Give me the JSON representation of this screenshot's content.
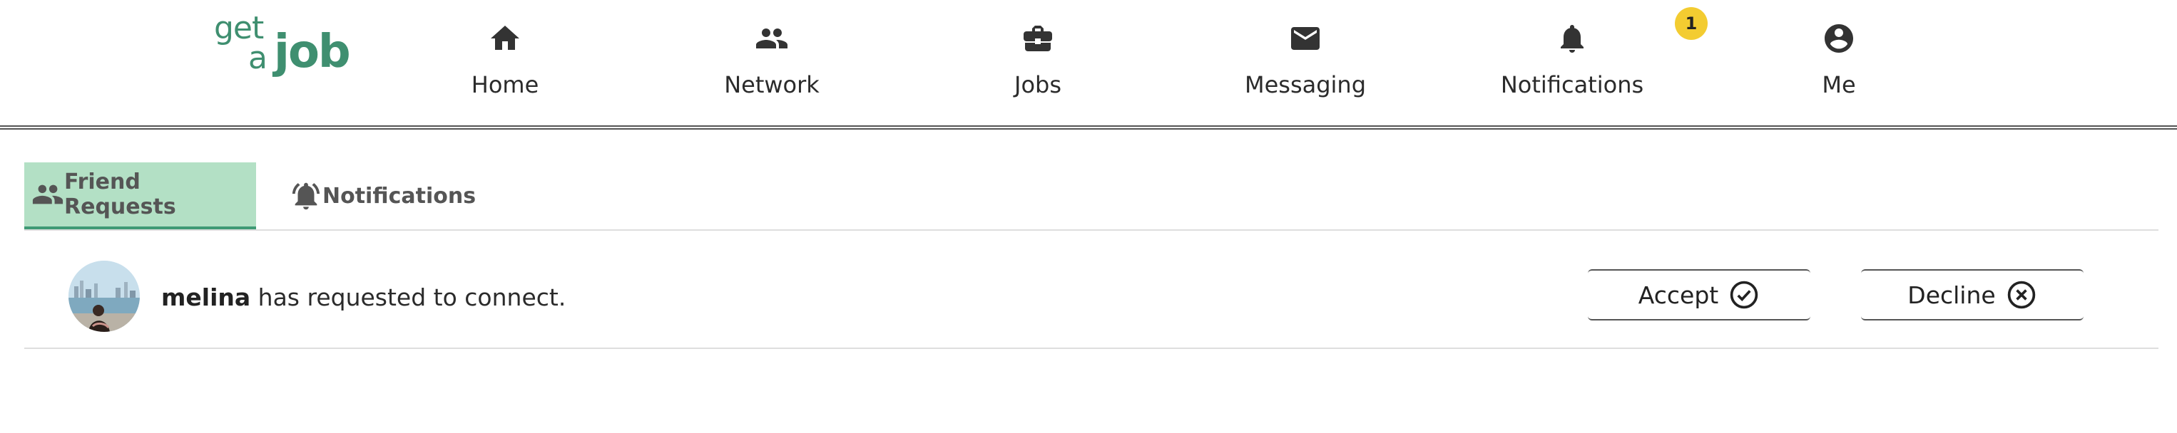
{
  "brand": {
    "line1": "get",
    "line2": "a",
    "line3": "job",
    "color": "#3f8f70"
  },
  "nav": [
    {
      "id": "home",
      "label": "Home",
      "icon": "home-icon"
    },
    {
      "id": "network",
      "label": "Network",
      "icon": "people-icon"
    },
    {
      "id": "jobs",
      "label": "Jobs",
      "icon": "briefcase-icon"
    },
    {
      "id": "messaging",
      "label": "Messaging",
      "icon": "envelope-icon"
    },
    {
      "id": "notifications",
      "label": "Notifications",
      "icon": "bell-icon",
      "badge": "1"
    },
    {
      "id": "me",
      "label": "Me",
      "icon": "account-circle-icon"
    }
  ],
  "tabs": [
    {
      "label": "Friend Requests",
      "icon": "people-icon",
      "active": true
    },
    {
      "label": "Notifications",
      "icon": "bell-ring-icon",
      "active": false
    }
  ],
  "requests": [
    {
      "name": "melina",
      "message": "has requested to connect.",
      "accept_label": "Accept",
      "decline_label": "Decline"
    }
  ],
  "colors": {
    "accent": "#3f9a75",
    "active_tab_bg": "#b3e0c5",
    "badge": "#f3cc31"
  }
}
